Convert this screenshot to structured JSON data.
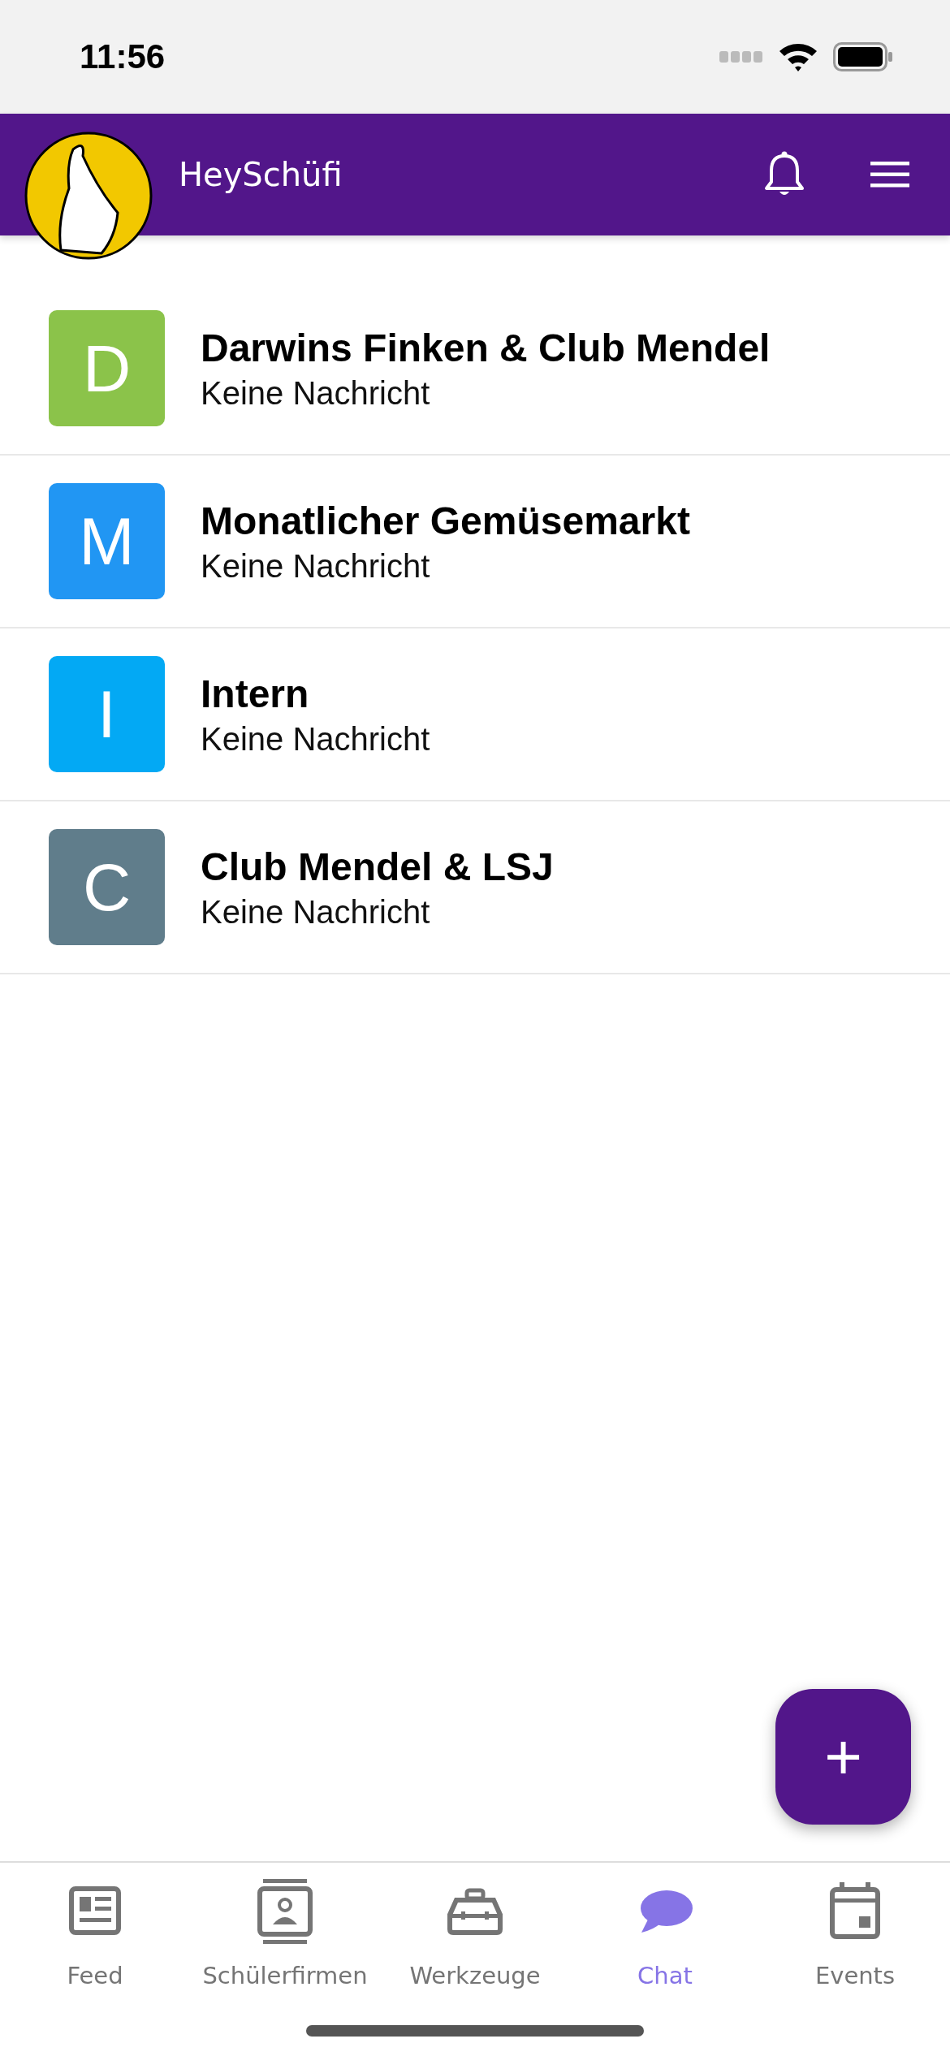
{
  "status_bar": {
    "time": "11:56"
  },
  "header": {
    "title": "HeySchüfi"
  },
  "chats": [
    {
      "initial": "D",
      "color": "#8bc34a",
      "name": "Darwins Finken & Club Mendel",
      "last_message": "Keine Nachricht"
    },
    {
      "initial": "M",
      "color": "#2196f3",
      "name": "Monatlicher Gemüsemarkt",
      "last_message": "Keine Nachricht"
    },
    {
      "initial": "I",
      "color": "#03a9f4",
      "name": "Intern",
      "last_message": "Keine Nachricht"
    },
    {
      "initial": "C",
      "color": "#607d8b",
      "name": "Club Mendel & LSJ",
      "last_message": "Keine Nachricht"
    }
  ],
  "fab": {
    "label": "+"
  },
  "tabs": [
    {
      "kind": "feed",
      "label": "Feed",
      "selected": false
    },
    {
      "kind": "companies",
      "label": "Schülerfirmen",
      "selected": false
    },
    {
      "kind": "tools",
      "label": "Werkzeuge",
      "selected": false
    },
    {
      "kind": "chat",
      "label": "Chat",
      "selected": true
    },
    {
      "kind": "events",
      "label": "Events",
      "selected": false
    }
  ]
}
